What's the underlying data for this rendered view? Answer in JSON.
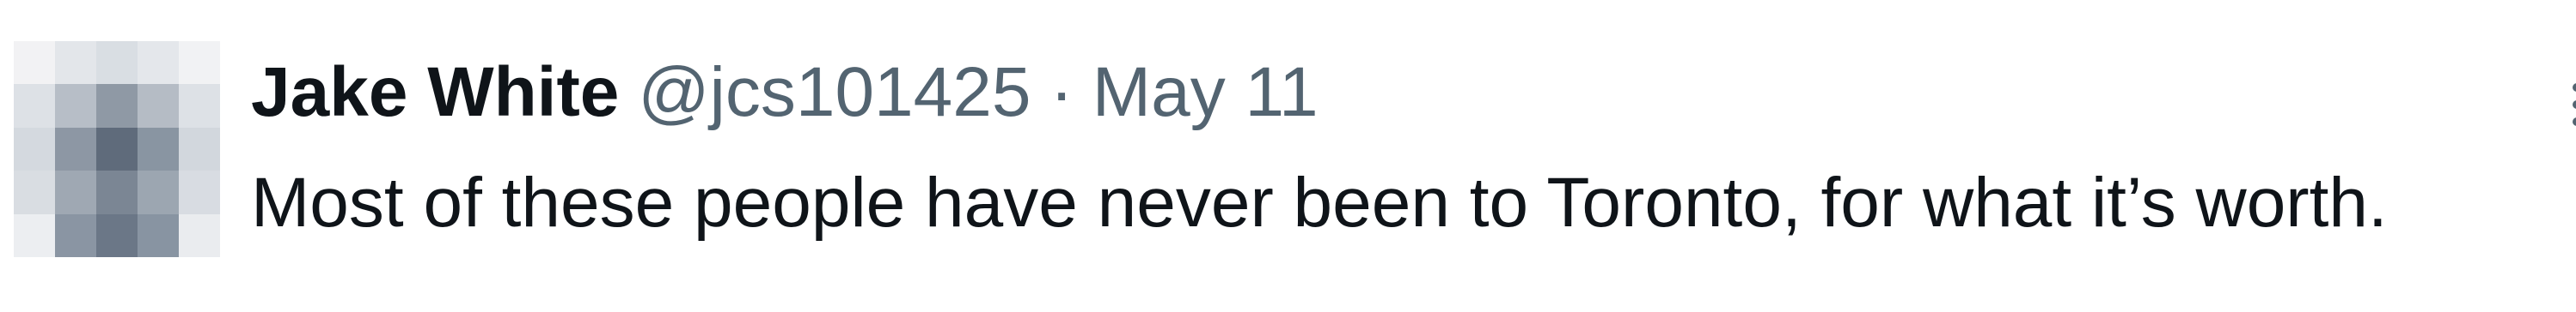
{
  "tweet": {
    "author": {
      "display_name": "Jake White",
      "handle": "@jcs101425"
    },
    "separator": "·",
    "timestamp": "May 11",
    "text": "Most of these people have never been to Toronto, for what it’s worth.",
    "avatar_icon": "blurred-avatar",
    "more_icon": "more-options-icon"
  },
  "colors": {
    "primary_text": "#0f1419",
    "secondary_text": "#536471",
    "background": "#ffffff"
  }
}
